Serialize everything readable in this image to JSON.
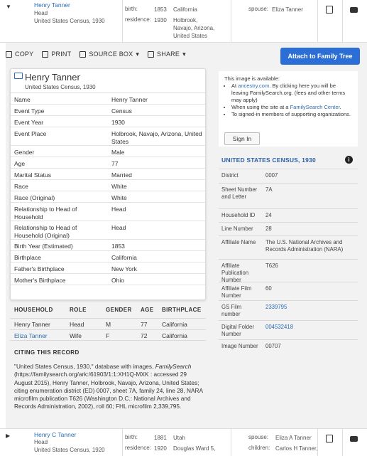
{
  "top_result": {
    "name": "Henry Tanner",
    "role": "Head",
    "collection": "United States Census, 1930",
    "birth_label": "birth:",
    "birth_year": "1853",
    "birth_place": "California",
    "residence_label": "residence:",
    "residence_year": "1930",
    "residence_place": "Holbrook, Navajo, Arizona, United States",
    "spouse_label": "spouse:",
    "spouse": "Eliza Tanner"
  },
  "toolbar": {
    "copy": "COPY",
    "print": "PRINT",
    "source_box": "SOURCE BOX",
    "share": "SHARE",
    "attach": "Attach to Family Tree"
  },
  "record": {
    "name": "Henry Tanner",
    "collection": "United States Census, 1930",
    "fields": [
      {
        "k": "Name",
        "v": "Henry Tanner"
      },
      {
        "k": "Event Type",
        "v": "Census"
      },
      {
        "k": "Event Year",
        "v": "1930"
      },
      {
        "k": "Event Place",
        "v": "Holbrook, Navajo, Arizona, United States"
      },
      {
        "k": "Gender",
        "v": "Male"
      },
      {
        "k": "Age",
        "v": "77"
      },
      {
        "k": "Marital Status",
        "v": "Married"
      },
      {
        "k": "Race",
        "v": "White"
      },
      {
        "k": "Race (Original)",
        "v": "White"
      },
      {
        "k": "Relationship to Head of Household",
        "v": "Head"
      },
      {
        "k": "Relationship to Head of Household (Original)",
        "v": "Head"
      },
      {
        "k": "Birth Year (Estimated)",
        "v": "1853"
      },
      {
        "k": "Birthplace",
        "v": "California"
      },
      {
        "k": "Father's Birthplace",
        "v": "New York"
      },
      {
        "k": "Mother's Birthplace",
        "v": "Ohio"
      }
    ]
  },
  "availability": {
    "intro": "This image is available:",
    "item1_pre": "At ",
    "item1_link": "ancestry.com",
    "item1_post": ". By clicking here you will be leaving FamilySearch.org. (fees and other terms may apply)",
    "item2_pre": "When using the site at a ",
    "item2_link": "FamilySearch Center",
    "item2_post": ".",
    "item3": "To signed-in members of supporting organizations.",
    "signin": "Sign In"
  },
  "census": {
    "title": "UNITED STATES CENSUS, 1930",
    "rows": [
      {
        "k": "District",
        "v": "0007"
      },
      {
        "k": "Sheet Number and Letter",
        "v": "7A"
      },
      {
        "k": "Household ID",
        "v": "24"
      },
      {
        "k": "Line Number",
        "v": "28"
      },
      {
        "k": "Affiliate Name",
        "v": "The U.S. National Archives and Records Administration (NARA)"
      },
      {
        "k": "Affiliate Publication Number",
        "v": "T626"
      },
      {
        "k": "Affiliate Film Number",
        "v": "60"
      },
      {
        "k": "GS Film number",
        "v": "2339795"
      },
      {
        "k": "Digital Folder Number",
        "v": "004532418"
      },
      {
        "k": "Image Number",
        "v": "00707"
      }
    ]
  },
  "household": {
    "headers": [
      "HOUSEHOLD",
      "ROLE",
      "GENDER",
      "AGE",
      "BIRTHPLACE"
    ],
    "rows": [
      {
        "name": "Henry Tanner",
        "role": "Head",
        "gender": "M",
        "age": "77",
        "birthplace": "California"
      },
      {
        "name": "Eliza Tanner",
        "role": "Wife",
        "gender": "F",
        "age": "72",
        "birthplace": "California"
      }
    ]
  },
  "citing": {
    "title": "CITING THIS RECORD",
    "text1": "\"United States Census, 1930,\" database with images, ",
    "text_italic": "FamilySearch",
    "text2": " (https://familysearch.org/ark:/61903/1:1:XH1Q-MXK : accessed 29 August 2015), Henry Tanner, Holbrook, Navajo, Arizona, United States; citing enumeration district (ED) 0007, sheet 7A, family 24, line 28, NARA microfilm publication T626 (Washington D.C.: National Archives and Records Administration, 2002), roll 60; FHL microfilm 2,339,795."
  },
  "bottom_result": {
    "name": "Henry C Tanner",
    "role": "Head",
    "collection": "United States Census, 1920",
    "birth_label": "birth:",
    "birth_year": "1881",
    "birth_place": "Utah",
    "residence_label": "residence:",
    "residence_year": "1920",
    "residence_place": "Douglas Ward 5,",
    "spouse_label": "spouse:",
    "spouse": "Eliza A Tanner",
    "children_label": "children:",
    "children": "Carlos H Tanner,"
  },
  "colors": {
    "accent": "#2b6fd6",
    "link": "#2b6cb0",
    "panel": "#f2f2f2"
  }
}
